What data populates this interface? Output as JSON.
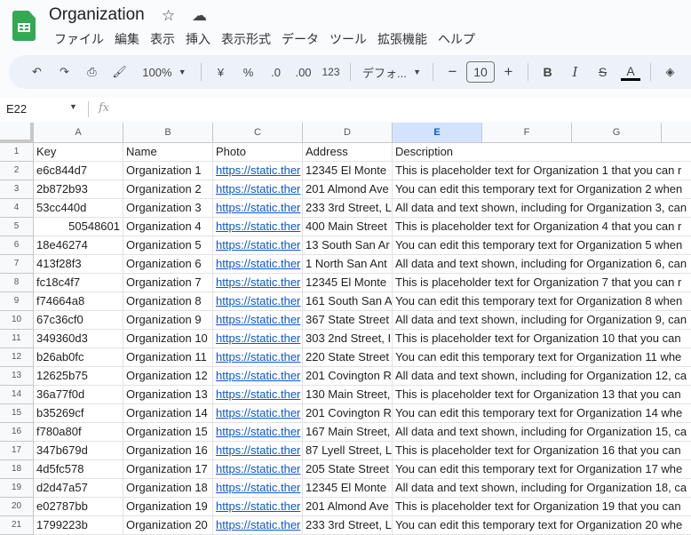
{
  "doc": {
    "title": "Organization",
    "star_icon": "☆",
    "cloud_icon": "☁"
  },
  "menu": [
    "ファイル",
    "編集",
    "表示",
    "挿入",
    "表示形式",
    "データ",
    "ツール",
    "拡張機能",
    "ヘルプ"
  ],
  "toolbar": {
    "zoom": "100%",
    "currency": "¥",
    "percent": "%",
    "dec_decrease": ".0",
    "dec_increase": ".00",
    "number_format": "123",
    "font": "デフォ...",
    "font_size": "10",
    "bold": "B",
    "italic": "I",
    "strike": "S",
    "text_color": "A"
  },
  "formula_bar": {
    "cell_ref": "E22",
    "fx": "fx",
    "value": ""
  },
  "columns": [
    "A",
    "B",
    "C",
    "D",
    "E",
    "F",
    "G",
    ""
  ],
  "selected_column": "E",
  "header_row": {
    "key": "Key",
    "name": "Name",
    "photo": "Photo",
    "address": "Address",
    "description": "Description"
  },
  "rows": [
    {
      "key": "e6c844d7",
      "name": "Organization 1",
      "photo": "https://static.ther",
      "address": "12345 El Monte",
      "description": "This is placeholder text for Organization 1 that you can r"
    },
    {
      "key": "2b872b93",
      "name": "Organization 2",
      "photo": "https://static.ther",
      "address": "201 Almond Ave",
      "description": "You can edit this temporary text for Organization 2 when"
    },
    {
      "key": "53cc440d",
      "name": "Organization 3",
      "photo": "https://static.ther",
      "address": "233 3rd Street, L",
      "description": "All data and text shown, including for Organization 3, can"
    },
    {
      "key": "50548601",
      "name": "Organization 4",
      "photo": "https://static.ther",
      "address": "400 Main Street",
      "description": "This is placeholder text for Organization 4 that you can r",
      "numeric": true
    },
    {
      "key": "18e46274",
      "name": "Organization 5",
      "photo": "https://static.ther",
      "address": "13 South San Ar",
      "description": "You can edit this temporary text for Organization 5 when"
    },
    {
      "key": "413f28f3",
      "name": "Organization 6",
      "photo": "https://static.ther",
      "address": "1 North San Ant",
      "description": "All data and text shown, including for Organization 6, can"
    },
    {
      "key": "fc18c4f7",
      "name": "Organization 7",
      "photo": "https://static.ther",
      "address": "12345 El Monte",
      "description": "This is placeholder text for Organization 7 that you can r"
    },
    {
      "key": "f74664a8",
      "name": "Organization 8",
      "photo": "https://static.ther",
      "address": "161 South San A",
      "description": "You can edit this temporary text for Organization 8 when"
    },
    {
      "key": "67c36cf0",
      "name": "Organization 9",
      "photo": "https://static.ther",
      "address": "367 State Street",
      "description": "All data and text shown, including for Organization 9, can"
    },
    {
      "key": "349360d3",
      "name": "Organization 10",
      "photo": "https://static.ther",
      "address": "303 2nd Street, I",
      "description": "This is placeholder text for Organization 10 that you can"
    },
    {
      "key": "b26ab0fc",
      "name": "Organization 11",
      "photo": "https://static.ther",
      "address": "220 State Street",
      "description": "You can edit this temporary text for Organization 11 whe"
    },
    {
      "key": "12625b75",
      "name": "Organization 12",
      "photo": "https://static.ther",
      "address": "201 Covington R",
      "description": "All data and text shown, including for Organization 12, ca"
    },
    {
      "key": "36a77f0d",
      "name": "Organization 13",
      "photo": "https://static.ther",
      "address": "130 Main Street,",
      "description": "This is placeholder text for Organization 13 that you can"
    },
    {
      "key": "b35269cf",
      "name": "Organization 14",
      "photo": "https://static.ther",
      "address": "201 Covington R",
      "description": "You can edit this temporary text for Organization 14 whe"
    },
    {
      "key": "f780a80f",
      "name": "Organization 15",
      "photo": "https://static.ther",
      "address": "167 Main Street,",
      "description": "All data and text shown, including for Organization 15, ca"
    },
    {
      "key": "347b679d",
      "name": "Organization 16",
      "photo": "https://static.ther",
      "address": "87 Lyell Street, L",
      "description": "This is placeholder text for Organization 16 that you can"
    },
    {
      "key": "4d5fc578",
      "name": "Organization 17",
      "photo": "https://static.ther",
      "address": "205 State Street",
      "description": "You can edit this temporary text for Organization 17 whe"
    },
    {
      "key": "d2d47a57",
      "name": "Organization 18",
      "photo": "https://static.ther",
      "address": "12345 El Monte",
      "description": "All data and text shown, including for Organization 18, ca"
    },
    {
      "key": "e02787bb",
      "name": "Organization 19",
      "photo": "https://static.ther",
      "address": "201 Almond Ave",
      "description": "This is placeholder text for Organization 19 that you can"
    },
    {
      "key": "1799223b",
      "name": "Organization 20",
      "photo": "https://static.ther",
      "address": "233 3rd Street, L",
      "description": "You can edit this temporary text for Organization 20 whe"
    }
  ],
  "colors": {
    "accent": "#0b57d0",
    "link": "#1155cc",
    "brand": "#34a853"
  }
}
